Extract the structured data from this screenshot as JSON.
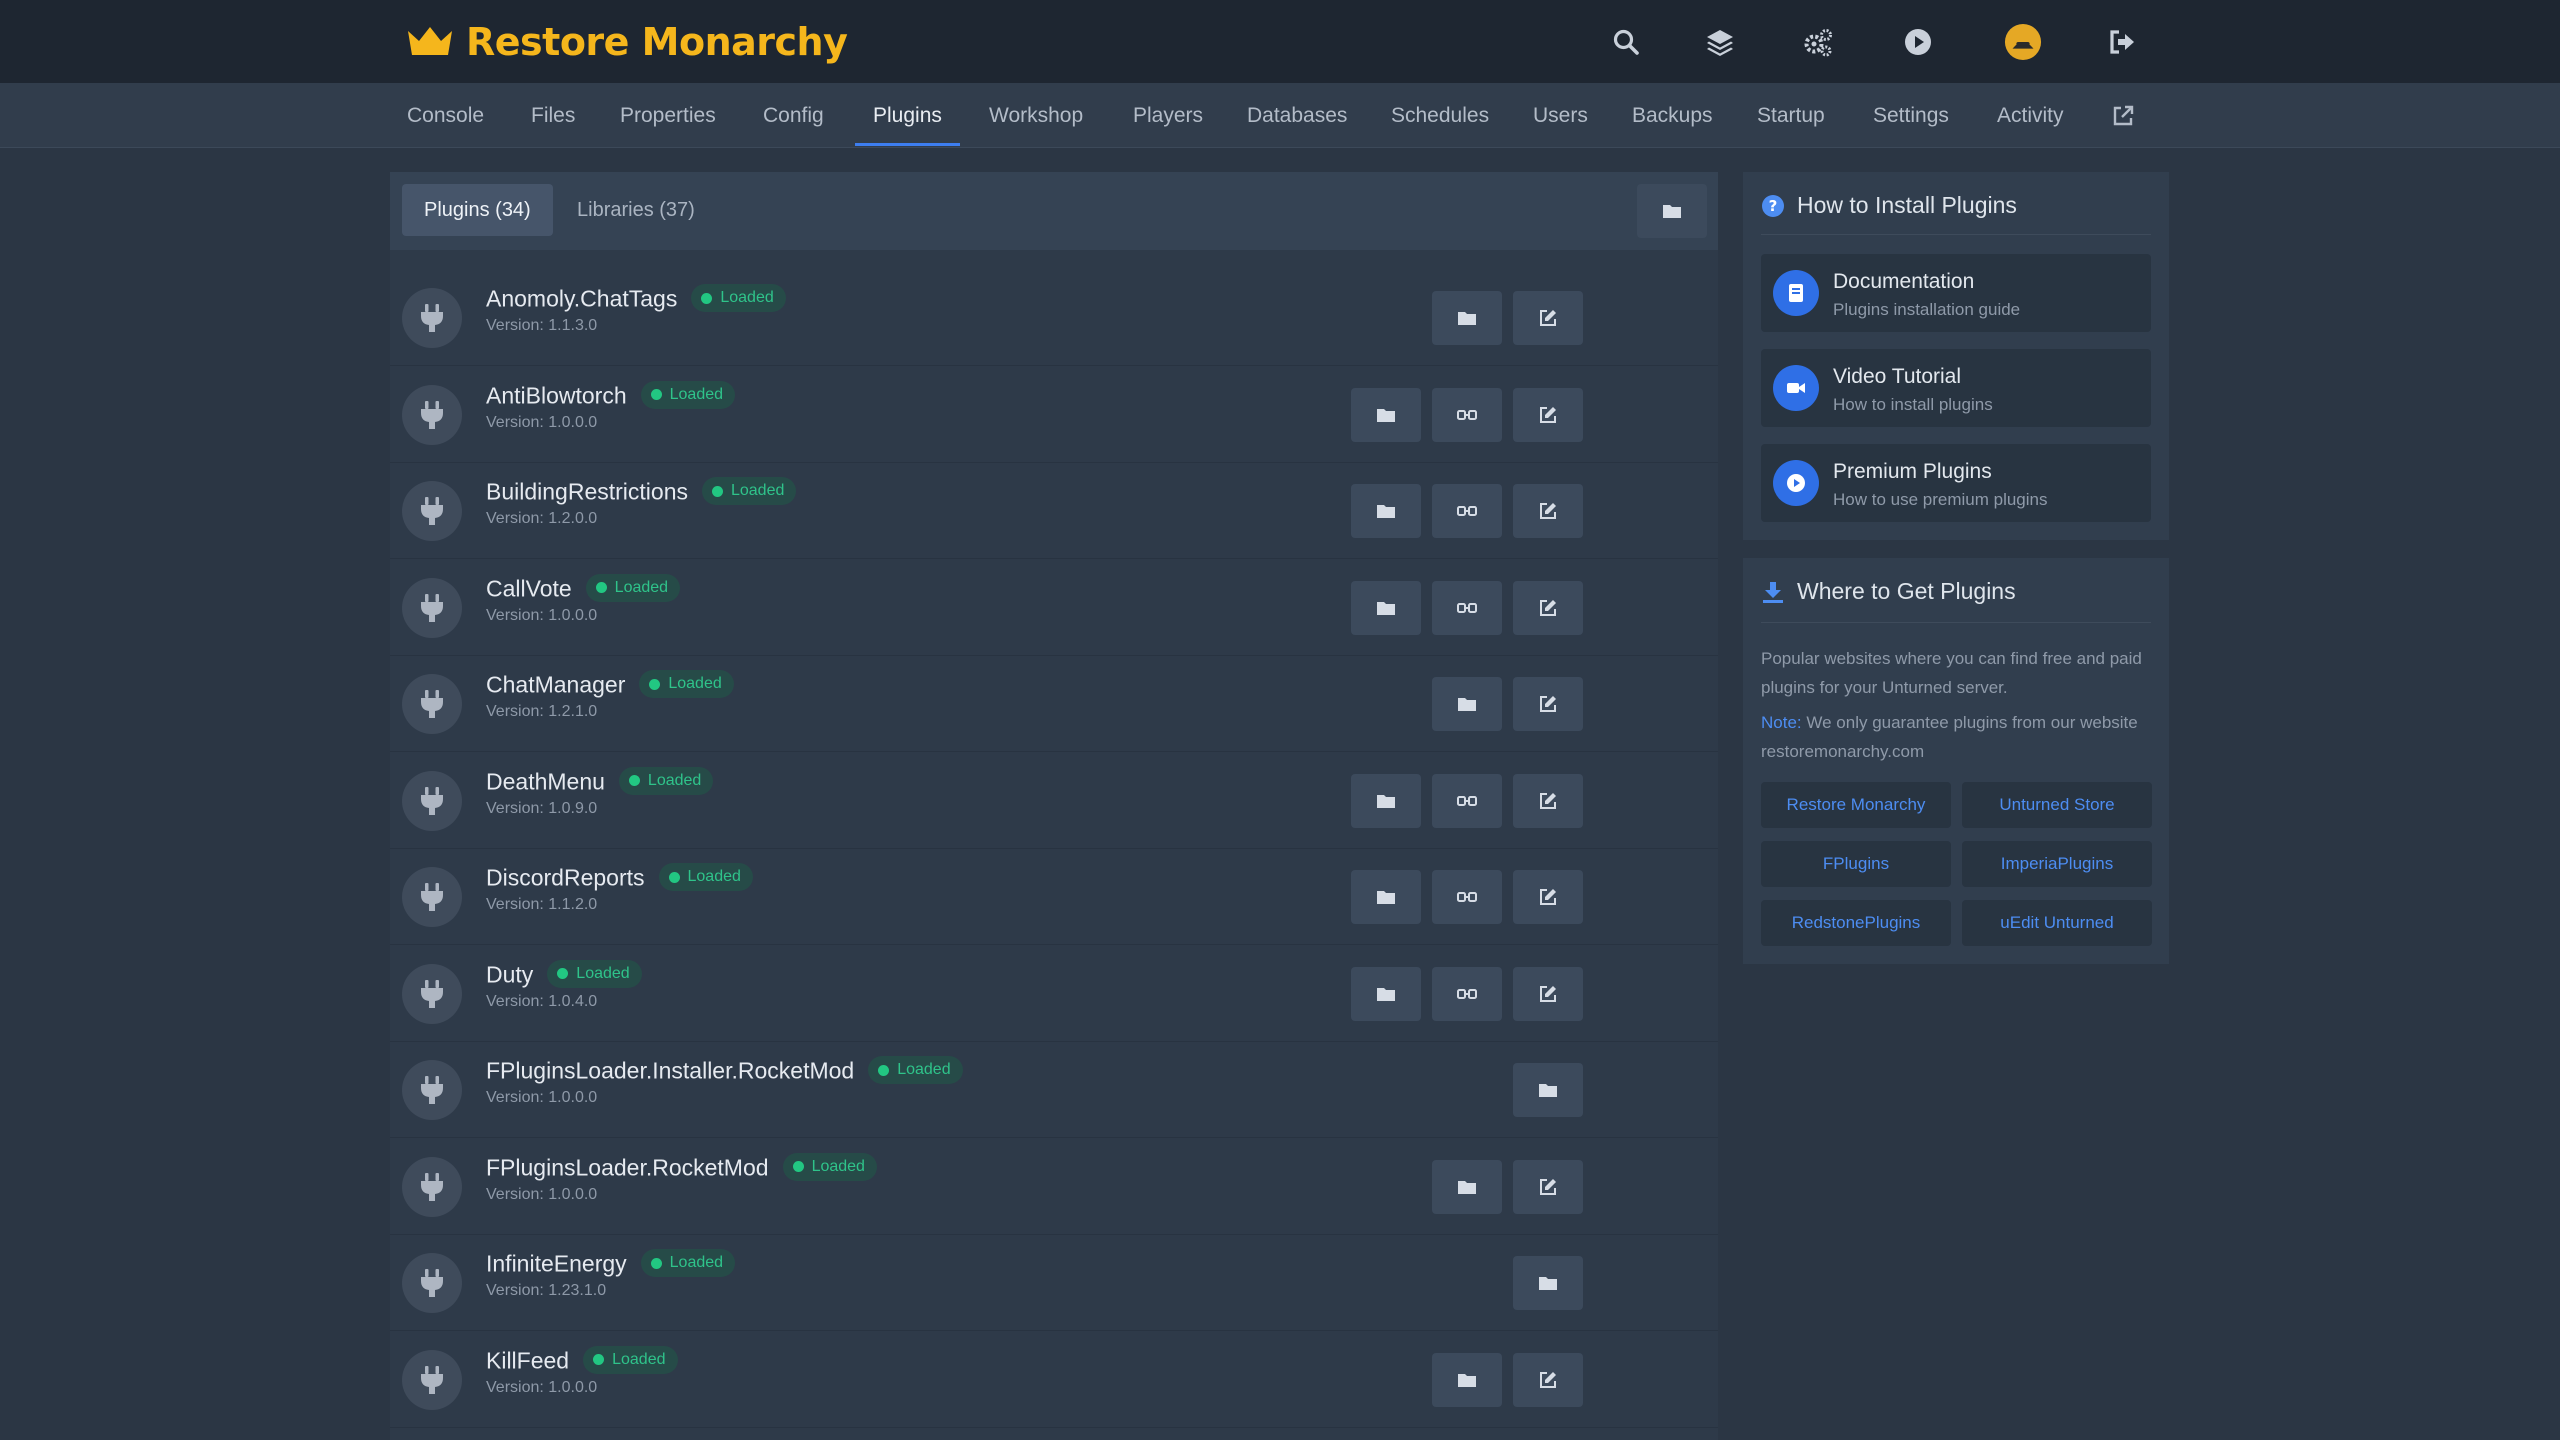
{
  "brand": {
    "title": "Restore Monarchy",
    "accent": "#f5b61c"
  },
  "top_icons": [
    "search-icon",
    "layers-icon",
    "cogs-icon",
    "play-icon",
    "avatar",
    "logout-icon"
  ],
  "nav": {
    "items": [
      "Console",
      "Files",
      "Properties",
      "Config",
      "Plugins",
      "Workshop",
      "Players",
      "Databases",
      "Schedules",
      "Users",
      "Backups",
      "Startup",
      "Settings",
      "Activity"
    ],
    "active": "Plugins"
  },
  "tabs": {
    "plugins": "Plugins (34)",
    "libraries": "Libraries (37)"
  },
  "plugins": [
    {
      "name": "Anomoly.ChatTags",
      "status": "Loaded",
      "version": "Version: 1.1.3.0",
      "buttons": [
        "folder",
        "edit"
      ]
    },
    {
      "name": "AntiBlowtorch",
      "status": "Loaded",
      "version": "Version: 1.0.0.0",
      "buttons": [
        "folder",
        "translation",
        "edit"
      ]
    },
    {
      "name": "BuildingRestrictions",
      "status": "Loaded",
      "version": "Version: 1.2.0.0",
      "buttons": [
        "folder",
        "translation",
        "edit"
      ]
    },
    {
      "name": "CallVote",
      "status": "Loaded",
      "version": "Version: 1.0.0.0",
      "buttons": [
        "folder",
        "translation",
        "edit"
      ]
    },
    {
      "name": "ChatManager",
      "status": "Loaded",
      "version": "Version: 1.2.1.0",
      "buttons": [
        "folder",
        "edit"
      ]
    },
    {
      "name": "DeathMenu",
      "status": "Loaded",
      "version": "Version: 1.0.9.0",
      "buttons": [
        "folder",
        "translation",
        "edit"
      ]
    },
    {
      "name": "DiscordReports",
      "status": "Loaded",
      "version": "Version: 1.1.2.0",
      "buttons": [
        "folder",
        "translation",
        "edit"
      ]
    },
    {
      "name": "Duty",
      "status": "Loaded",
      "version": "Version: 1.0.4.0",
      "buttons": [
        "folder",
        "translation",
        "edit"
      ]
    },
    {
      "name": "FPluginsLoader.Installer.RocketMod",
      "status": "Loaded",
      "version": "Version: 1.0.0.0",
      "buttons": [
        "folder"
      ]
    },
    {
      "name": "FPluginsLoader.RocketMod",
      "status": "Loaded",
      "version": "Version: 1.0.0.0",
      "buttons": [
        "folder",
        "edit"
      ]
    },
    {
      "name": "InfiniteEnergy",
      "status": "Loaded",
      "version": "Version: 1.23.1.0",
      "buttons": [
        "folder"
      ]
    },
    {
      "name": "KillFeed",
      "status": "Loaded",
      "version": "Version: 1.0.0.0",
      "buttons": [
        "folder",
        "edit"
      ]
    }
  ],
  "install_card": {
    "title": "How to Install Plugins",
    "links": [
      {
        "title": "Documentation",
        "subtitle": "Plugins installation guide",
        "icon": "book-icon"
      },
      {
        "title": "Video Tutorial",
        "subtitle": "How to install plugins",
        "icon": "video-icon"
      },
      {
        "title": "Premium Plugins",
        "subtitle": "How to use premium plugins",
        "icon": "play-circle-icon"
      }
    ]
  },
  "sources_card": {
    "title": "Where to Get Plugins",
    "description": "Popular websites where you can find free and paid plugins for your Unturned server.",
    "note_label": "Note:",
    "note_text": " We only guarantee plugins from our website restoremonarchy.com",
    "sites": [
      "Restore Monarchy",
      "Unturned Store",
      "FPlugins",
      "ImperiaPlugins",
      "RedstonePlugins",
      "uEdit Unturned"
    ]
  },
  "colors": {
    "loaded_badge": "#22c782",
    "link_blue": "#4d8df2",
    "active_underline": "#3d7ef0"
  }
}
